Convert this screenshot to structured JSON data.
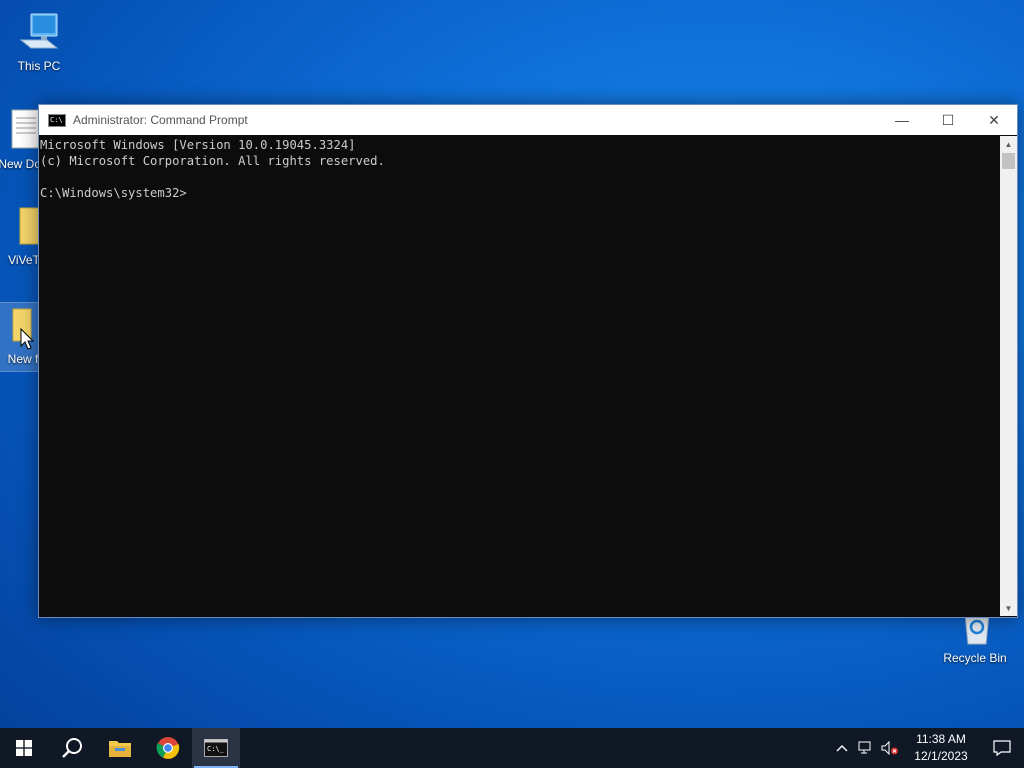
{
  "desktop": {
    "icons": [
      {
        "label": "This PC"
      },
      {
        "label": "New Docu"
      },
      {
        "label": "ViVeToo"
      },
      {
        "label": "New f"
      },
      {
        "label": "Recycle Bin"
      }
    ]
  },
  "window": {
    "title": "Administrator: Command Prompt",
    "app_icon_text": "C:\\",
    "console_lines": [
      "Microsoft Windows [Version 10.0.19045.3324]",
      "(c) Microsoft Corporation. All rights reserved.",
      "",
      "C:\\Windows\\system32>"
    ],
    "controls": {
      "minimize": "—",
      "maximize": "☐",
      "close": "✕"
    }
  },
  "taskbar": {
    "apps": [
      "start",
      "search",
      "file-explorer",
      "chrome",
      "command-prompt"
    ],
    "active_app": "command-prompt",
    "clock": {
      "time": "11:38 AM",
      "date": "12/1/2023"
    }
  },
  "colors": {
    "accent": "#0e6fd8",
    "taskbar": "#101826",
    "console_bg": "#0c0c0c",
    "console_fg": "#cccccc"
  }
}
